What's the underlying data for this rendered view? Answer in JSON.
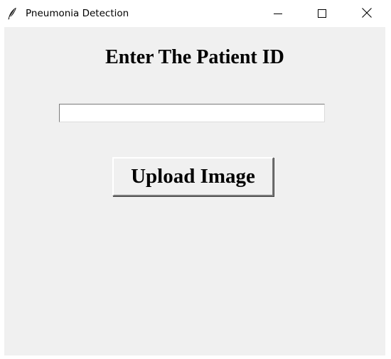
{
  "window": {
    "title": "Pneumonia Detection",
    "icon": "feather-icon",
    "controls": {
      "minimize": "minimize-icon",
      "maximize": "maximize-icon",
      "close": "close-icon"
    }
  },
  "form": {
    "heading": "Enter The Patient ID",
    "patient_id_value": "",
    "patient_id_placeholder": "",
    "upload_label": "Upload Image"
  },
  "colors": {
    "client_background": "#f0f0f0",
    "titlebar_background": "#ffffff"
  }
}
